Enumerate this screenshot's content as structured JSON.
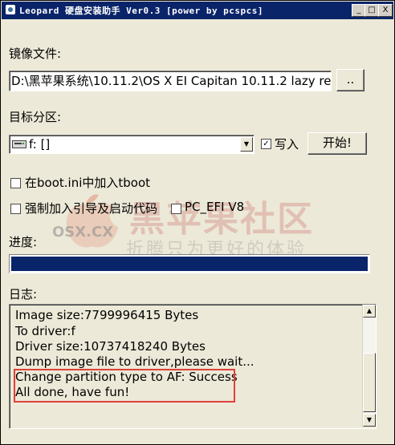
{
  "window": {
    "title": "Leopard 硬盘安装助手 Ver0.3 [power by pcspcs]",
    "controls": {
      "minimize": "_",
      "maximize": "□",
      "close": "X"
    }
  },
  "image_file": {
    "label": "镜像文件:",
    "value": "D:\\黑苹果系统\\10.11.2\\OS X EI Capitan 10.11.2 lazy re",
    "browse_label": ".."
  },
  "target_partition": {
    "label": "目标分区:",
    "selected": "f: []",
    "write_label": "写入",
    "write_checked": true,
    "start_label": "开始!"
  },
  "options": {
    "tboot_label": "在boot.ini中加入tboot",
    "force_boot_label": "强制加入引导及启动代码",
    "pc_efi_label": "PC_EFI V8"
  },
  "progress": {
    "label": "进度:",
    "fraction": 1.0
  },
  "log": {
    "label": "日志:",
    "lines": [
      "Image size:7799996415 Bytes",
      "To driver:f",
      "Driver size:10737418240 Bytes",
      "Dump image file to driver,please wait...",
      "Change partition type to AF: Success",
      "All done, have fun!"
    ]
  },
  "watermark": {
    "site": "黑苹果社区",
    "domain": "OSX.CX",
    "slogan": "折腾只为更好的体验"
  },
  "colors": {
    "titlebar": "#0a246a",
    "progress_fill": "#0a246a",
    "highlight": "#e0403a"
  }
}
